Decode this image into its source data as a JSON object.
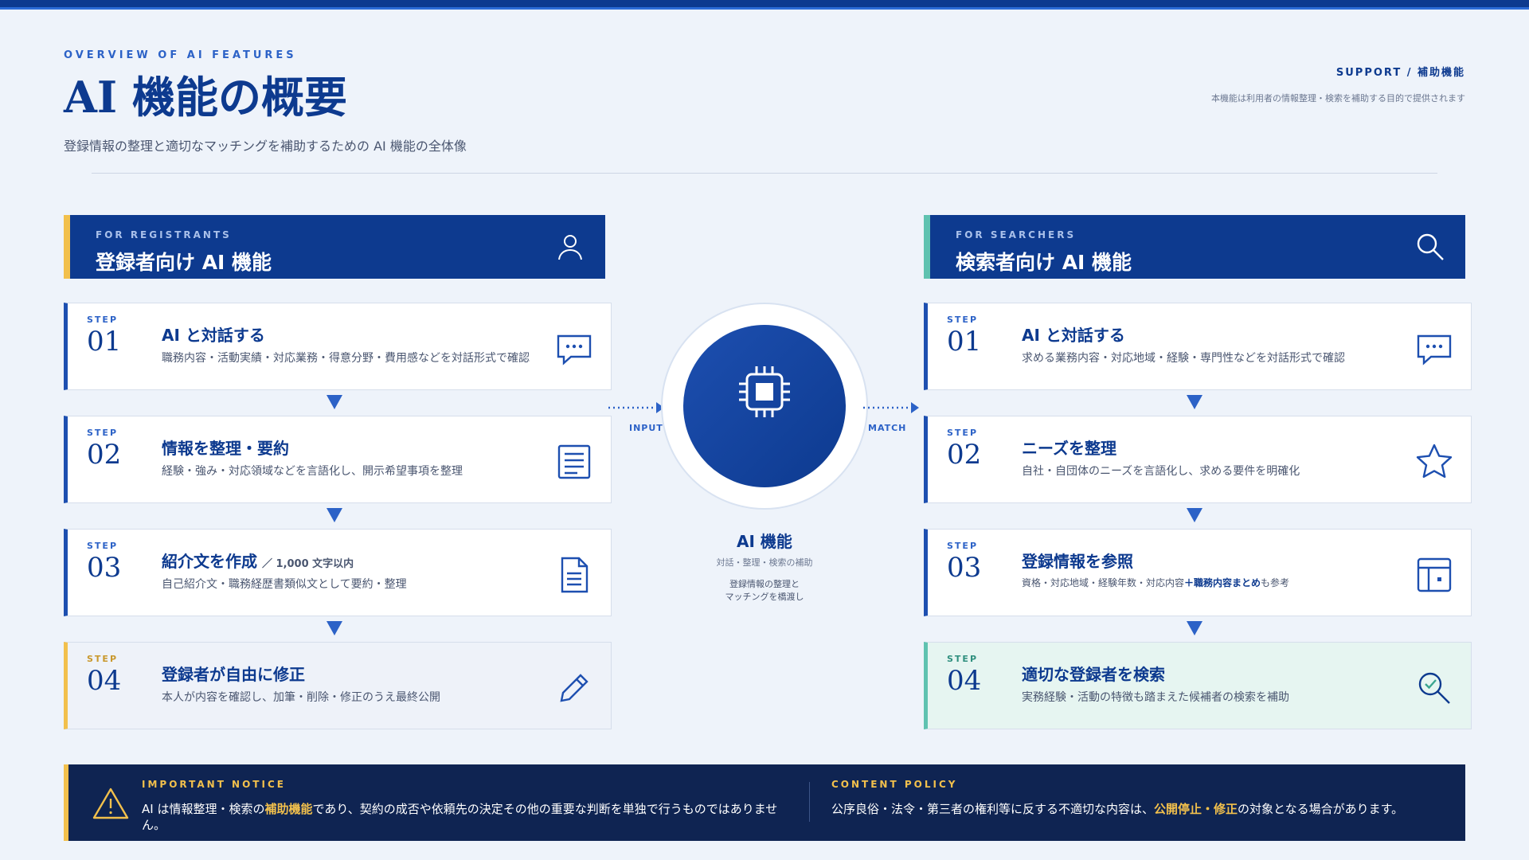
{
  "header": {
    "eyebrow": "OVERVIEW OF AI FEATURES",
    "title": "AI 機能の概要",
    "subtitle": "登録情報の整理と適切なマッチングを補助するための AI 機能の全体像",
    "support_label": "SUPPORT / 補助機能",
    "support_note": "本機能は利用者の情報整理・検索を補助する目的で提供されます"
  },
  "registrants": {
    "eyebrow": "FOR REGISTRANTS",
    "title": "登録者向け AI 機能",
    "icon": "user-icon",
    "steps": [
      {
        "label": "STEP",
        "num": "01",
        "title": "AI と対話する",
        "desc": "職務内容・活動実績・対応業務・得意分野・費用感などを対話形式で確認",
        "icon": "chat-icon"
      },
      {
        "label": "STEP",
        "num": "02",
        "title": "情報を整理・要約",
        "desc": "経験・強み・対応領域などを言語化し、開示希望事項を整理",
        "icon": "list-icon"
      },
      {
        "label": "STEP",
        "num": "03",
        "title": "紹介文を作成",
        "title_sub": "／ 1,000 文字以内",
        "desc": "自己紹介文・職務経歴書類似文として要約・整理",
        "icon": "document-icon"
      },
      {
        "label": "STEP",
        "num": "04",
        "title": "登録者が自由に修正",
        "desc": "本人が内容を確認し、加筆・削除・修正のうえ最終公開",
        "icon": "pencil-icon"
      }
    ]
  },
  "searchers": {
    "eyebrow": "FOR SEARCHERS",
    "title": "検索者向け AI 機能",
    "icon": "search-icon",
    "steps": [
      {
        "label": "STEP",
        "num": "01",
        "title": "AI と対話する",
        "desc": "求める業務内容・対応地域・経験・専門性などを対話形式で確認",
        "icon": "chat-icon"
      },
      {
        "label": "STEP",
        "num": "02",
        "title": "ニーズを整理",
        "desc": "自社・自団体のニーズを言語化し、求める要件を明確化",
        "icon": "star-icon"
      },
      {
        "label": "STEP",
        "num": "03",
        "title": "登録情報を参照",
        "desc_pre": "資格・対応地域・経験年数・対応内容",
        "desc_bold": "＋職務内容まとめ",
        "desc_post": "も参考",
        "icon": "table-icon"
      },
      {
        "label": "STEP",
        "num": "04",
        "title": "適切な登録者を検索",
        "desc": "実務経験・活動の特徴も踏まえた候補者の検索を補助",
        "icon": "search-check-icon"
      }
    ]
  },
  "hub": {
    "title": "AI 機能",
    "sub": "対話・整理・検索の補助",
    "note_line1": "登録情報の整理と",
    "note_line2": "マッチングを橋渡し",
    "input_label": "INPUT",
    "match_label": "MATCH",
    "icon": "chip-icon"
  },
  "notice": {
    "left_eyebrow": "IMPORTANT NOTICE",
    "left_pre": "AI は情報整理・検索の",
    "left_hl": "補助機能",
    "left_post": "であり、契約の成否や依頼先の決定その他の重要な判断を単独で行うものではありません。",
    "right_eyebrow": "CONTENT POLICY",
    "right_pre": "公序良俗・法令・第三者の権利等に反する不適切な内容は、",
    "right_hl": "公開停止・修正",
    "right_post": "の対象となる場合があります。",
    "icon": "warning-icon"
  },
  "colors": {
    "navy": "#0d3a8f",
    "accent_blue": "#2c62c7",
    "gold": "#f2c04c",
    "teal": "#5fc2b0",
    "notice_bg": "#0f2452"
  }
}
